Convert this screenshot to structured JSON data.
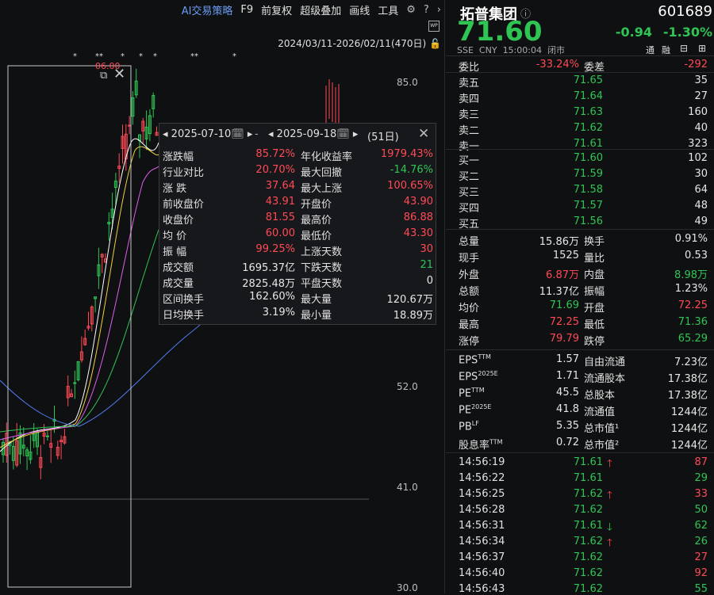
{
  "toolbar": {
    "ai": "AI交易策略",
    "f9": "F9",
    "fq": "前复权",
    "overlay": "超级叠加",
    "draw": "画线",
    "tools": "工具",
    "gear": "⚙",
    "help": "?",
    "next": "›"
  },
  "range_text": "2024/03/11-2026/02/11(470日)",
  "y_axis": [
    "85.0",
    "52.0",
    "41.0",
    "30.0"
  ],
  "marker_text": "06.00",
  "popup": {
    "start_date": "2025-07-10",
    "end_date": "2025-09-18",
    "days": "(51日)",
    "left": [
      [
        "涨跌幅",
        "85.72%",
        "red"
      ],
      [
        "行业对比",
        "20.70%",
        "red"
      ],
      [
        "涨  跌",
        "37.64",
        "red"
      ],
      [
        "前收盘价",
        "43.91",
        "red"
      ],
      [
        "收盘价",
        "81.55",
        "red"
      ],
      [
        "均  价",
        "60.00",
        "red"
      ],
      [
        "振  幅",
        "99.25%",
        "red"
      ],
      [
        "成交额",
        "1695.37亿",
        "wht"
      ],
      [
        "成交量",
        "2825.48万",
        "wht"
      ],
      [
        "区间换手",
        "162.60%",
        "wht"
      ],
      [
        "日均换手",
        "3.19%",
        "wht"
      ]
    ],
    "right": [
      [
        "年化收益率",
        "1979.43%",
        "red"
      ],
      [
        "最大回撤",
        "-14.76%",
        "grn"
      ],
      [
        "最大上涨",
        "100.65%",
        "red"
      ],
      [
        "开盘价",
        "43.90",
        "red"
      ],
      [
        "最高价",
        "86.88",
        "red"
      ],
      [
        "最低价",
        "43.30",
        "red"
      ],
      [
        "上涨天数",
        "30",
        "red"
      ],
      [
        "下跌天数",
        "21",
        "grn"
      ],
      [
        "平盘天数",
        "0",
        "wht"
      ],
      [
        "最大量",
        "120.67万",
        "wht"
      ],
      [
        "最小量",
        "18.89万",
        "wht"
      ]
    ]
  },
  "stock": {
    "name": "拓普集团",
    "code": "601689",
    "price": "71.60",
    "change": "-0.94",
    "pct": "-1.30%",
    "exchange": "SSE",
    "currency": "CNY",
    "time": "15:00:04",
    "status": "闭市",
    "tong": "通",
    "rong": "融"
  },
  "weibi": {
    "l1": "委比",
    "v1": "-33.24%",
    "l2": "委差",
    "v2": "-292"
  },
  "asks": [
    [
      "卖五",
      "71.65",
      "35"
    ],
    [
      "卖四",
      "71.64",
      "27"
    ],
    [
      "卖三",
      "71.63",
      "160"
    ],
    [
      "卖二",
      "71.62",
      "40"
    ],
    [
      "卖一",
      "71.61",
      "323"
    ]
  ],
  "bids": [
    [
      "买一",
      "71.60",
      "102"
    ],
    [
      "买二",
      "71.59",
      "30"
    ],
    [
      "买三",
      "71.58",
      "64"
    ],
    [
      "买四",
      "71.57",
      "48"
    ],
    [
      "买五",
      "71.56",
      "49"
    ]
  ],
  "stats": [
    [
      "总量",
      "15.86万",
      "wht",
      "换手",
      "0.91%",
      "wht"
    ],
    [
      "现手",
      "1525",
      "wht",
      "量比",
      "0.53",
      "wht"
    ],
    [
      "外盘",
      "6.87万",
      "red",
      "内盘",
      "8.98万",
      "grn"
    ],
    [
      "总额",
      "11.37亿",
      "wht",
      "振幅",
      "1.23%",
      "wht"
    ],
    [
      "均价",
      "71.69",
      "grn",
      "开盘",
      "72.25",
      "red"
    ],
    [
      "最高",
      "72.25",
      "red",
      "最低",
      "71.36",
      "grn"
    ],
    [
      "涨停",
      "79.79",
      "red",
      "跌停",
      "65.29",
      "grn"
    ]
  ],
  "fund": [
    [
      "EPS",
      "TTM",
      "1.57",
      "自由流通",
      "7.23亿"
    ],
    [
      "EPS",
      "2025E",
      "1.71",
      "流通股本",
      "17.38亿"
    ],
    [
      "PE",
      "TTM",
      "45.5",
      "总股本",
      "17.38亿"
    ],
    [
      "PE",
      "2025E",
      "41.8",
      "流通值",
      "1244亿"
    ],
    [
      "PB",
      "LF",
      "5.35",
      "总市值¹",
      "1244亿"
    ],
    [
      "股息率",
      "TTM",
      "0.72",
      "总市值²",
      "1244亿"
    ]
  ],
  "ticks": [
    [
      "14:56:19",
      "71.61",
      "up",
      "87",
      "red"
    ],
    [
      "14:56:22",
      "71.61",
      "",
      "29",
      "grn"
    ],
    [
      "14:56:25",
      "71.62",
      "up",
      "33",
      "red"
    ],
    [
      "14:56:28",
      "71.62",
      "",
      "50",
      "grn"
    ],
    [
      "14:56:31",
      "71.61",
      "down",
      "62",
      "grn"
    ],
    [
      "14:56:34",
      "71.62",
      "up",
      "26",
      "grn"
    ],
    [
      "14:56:37",
      "71.62",
      "",
      "27",
      "red"
    ],
    [
      "14:56:40",
      "71.62",
      "",
      "92",
      "red"
    ],
    [
      "14:56:43",
      "71.62",
      "",
      "55",
      "grn"
    ]
  ]
}
